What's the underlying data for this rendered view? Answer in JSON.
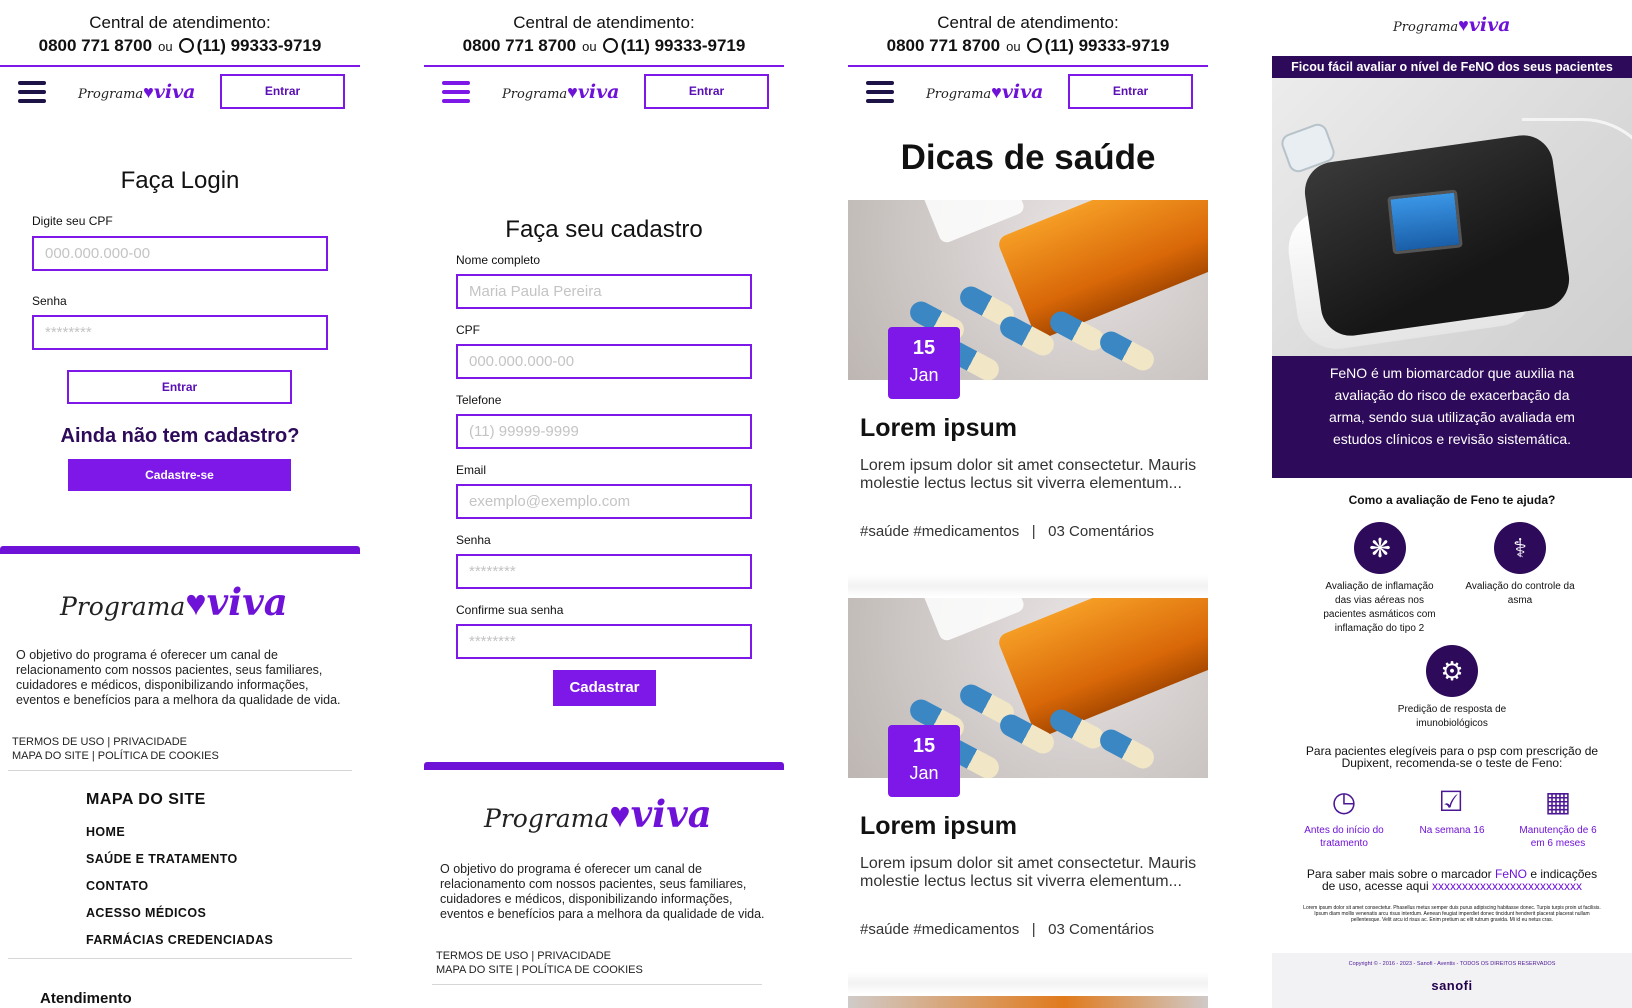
{
  "colors": {
    "accent": "#7d18e8",
    "dark_purple": "#2e0a5a",
    "navy": "#1d1347"
  },
  "header": {
    "central": "Central de atendimento:",
    "phone": "0800 771 8700",
    "ou": "ou",
    "whatsapp": "(11) 99333-9719",
    "whatsapp_icon": "whatsapp-icon",
    "menu_icon": "hamburger-icon",
    "logo_programa": "Programa",
    "logo_viva": "viva",
    "login_button": "Entrar"
  },
  "login": {
    "title": "Faça Login",
    "cpf_label": "Digite seu CPF",
    "cpf_placeholder": "000.000.000-00",
    "password_label": "Senha",
    "password_placeholder": "********",
    "submit": "Entrar",
    "no_account": "Ainda não tem cadastro?",
    "signup_button": "Cadastre-se"
  },
  "signup": {
    "title": "Faça seu cadastro",
    "fields": [
      {
        "label": "Nome completo",
        "placeholder": "Maria Paula Pereira"
      },
      {
        "label": "CPF",
        "placeholder": "000.000.000-00"
      },
      {
        "label": "Telefone",
        "placeholder": "(11) 99999-9999"
      },
      {
        "label": "Email",
        "placeholder": "exemplo@exemplo.com"
      },
      {
        "label": "Senha",
        "placeholder": "********"
      },
      {
        "label": "Confirme sua senha",
        "placeholder": "********"
      }
    ],
    "submit": "Cadastrar"
  },
  "footer": {
    "about": "O objetivo do programa é oferecer um canal de relacionamento com nossos pacientes, seus familiares, cuidadores e médicos, disponibilizando informações, eventos e benefícios para a melhora da qualidade de vida.",
    "links_line1": "TERMOS DE USO | PRIVACIDADE",
    "links_line2": "MAPA DO SITE | POLÍTICA DE COOKIES",
    "sitemap_title": "MAPA DO SITE",
    "sitemap_items": [
      "HOME",
      "SAÚDE E TRATAMENTO",
      "CONTATO",
      "ACESSO MÉDICOS",
      "FARMÁCIAS CREDENCIADAS"
    ],
    "atendimento": "Atendimento"
  },
  "blog": {
    "title": "Dicas de saúde",
    "posts": [
      {
        "day": "15",
        "month": "Jan",
        "title": "Lorem ipsum",
        "excerpt": "Lorem ipsum dolor sit amet consectetur. Mauris molestie lectus lectus sit viverra elementum...",
        "meta": "#saúde #medicamentos   |   03 Comentários"
      },
      {
        "day": "15",
        "month": "Jan",
        "title": "Lorem ipsum",
        "excerpt": "Lorem ipsum dolor sit amet consectetur. Mauris molestie lectus lectus sit viverra elementum...",
        "meta": "#saúde #medicamentos   |   03 Comentários"
      }
    ]
  },
  "feno": {
    "banner": "Ficou fácil avaliar o nível de FeNO dos seus pacientes",
    "description": "FeNO é um biomarcador que auxilia na avaliação do risco de exacerbação da arma, sendo sua utilização avaliada em estudos clínicos e revisão sistemática.",
    "how_title": "Como a avaliação de Feno te ajuda?",
    "benefits": [
      {
        "icon": "lungs-icon",
        "text": "Avaliação de inflamação das vias aéreas nos pacientes asmáticos com inflamação do tipo 2"
      },
      {
        "icon": "stethoscope-icon",
        "text": "Avaliação do controle da asma"
      },
      {
        "icon": "head-gear-icon",
        "text": "Predição de resposta de imunobiológicos"
      }
    ],
    "eligible": "Para pacientes elegíveis para o psp com prescrição de Dupixent, recomenda-se o teste de Feno:",
    "steps": [
      {
        "icon": "clock-icon",
        "text": "Antes do início do tratamento"
      },
      {
        "icon": "checklist-icon",
        "text": "Na semana 16"
      },
      {
        "icon": "calendar-icon",
        "text": "Manutenção de 6 em 6 meses"
      }
    ],
    "more_pre": "Para saber mais sobre o marcador ",
    "more_feno": "FeNO",
    "more_post": " e indicações de uso, acesse aqui ",
    "more_link": "xxxxxxxxxxxxxxxxxxxxxxxxx",
    "lorem": "Lorem ipsum dolor sit amet consectetur. Phasellus metus semper duis purus adipiscing habitasse donec. Turpis turpis proin ut facilisis. Ipsum diam mollis venenatis arcu risus interdum. Aenean feugiat imperdiet donec tincidunt hendrerit placerat placerat nullam pellentesque. Velit arcu id risus ac. Enim pretium ac elit rutrum gravida. Mi id eu netus cras.",
    "copyright": "Copyright © - 2016 - 2023 - Sanofi - Aventis - TODOS OS DIREITOS RESERVADOS",
    "brand": "sanofi"
  }
}
